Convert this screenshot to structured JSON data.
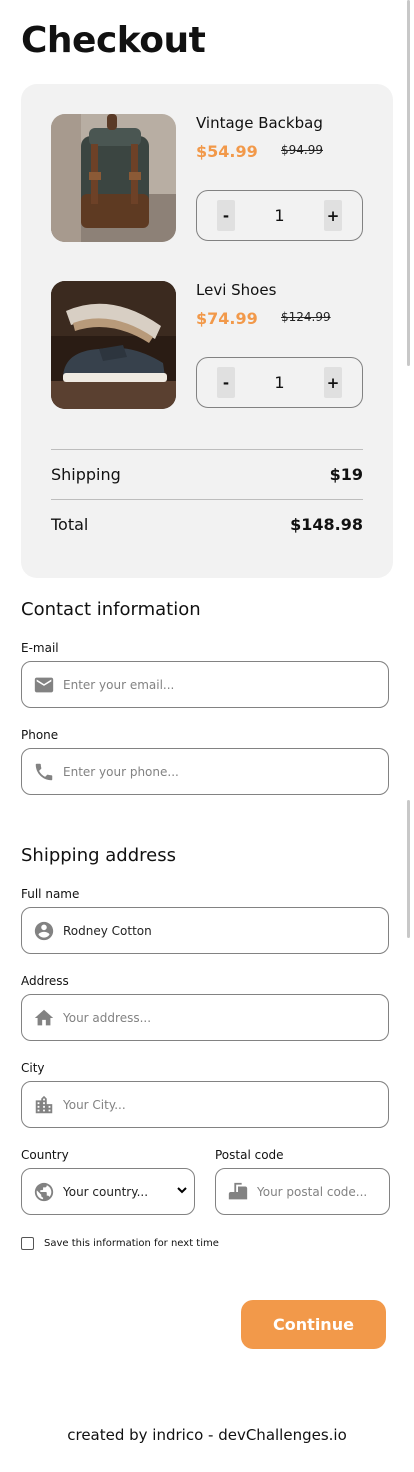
{
  "page": {
    "title": "Checkout"
  },
  "cart": {
    "items": [
      {
        "name": "Vintage Backbag",
        "price": "$54.99",
        "old_price": "$94.99",
        "quantity": "1",
        "minus": "-",
        "plus": "+",
        "image_icon": "backpack-photo"
      },
      {
        "name": "Levi Shoes",
        "price": "$74.99",
        "old_price": "$124.99",
        "quantity": "1",
        "minus": "-",
        "plus": "+",
        "image_icon": "shoe-photo"
      }
    ],
    "shipping": {
      "label": "Shipping",
      "value": "$19"
    },
    "total": {
      "label": "Total",
      "value": "$148.98"
    }
  },
  "contact": {
    "title": "Contact information",
    "email": {
      "label": "E-mail",
      "placeholder": "Enter your email...",
      "icon": "mail-icon"
    },
    "phone": {
      "label": "Phone",
      "placeholder": "Enter your phone...",
      "icon": "phone-icon"
    }
  },
  "shipping_address": {
    "title": "Shipping address",
    "full_name": {
      "label": "Full name",
      "value": "Rodney Cotton",
      "icon": "person-icon"
    },
    "address": {
      "label": "Address",
      "placeholder": "Your address...",
      "icon": "home-icon"
    },
    "city": {
      "label": "City",
      "placeholder": "Your City...",
      "icon": "building-icon"
    },
    "country": {
      "label": "Country",
      "selected": "Your country...",
      "icon": "globe-icon"
    },
    "postal": {
      "label": "Postal code",
      "placeholder": "Your postal code...",
      "icon": "mailbox-icon"
    }
  },
  "save_info": {
    "label": "Save this information for next time",
    "checked": false
  },
  "continue_button": "Continue",
  "footer": "created by indrico - devChallenges.io",
  "colors": {
    "accent": "#f2994a",
    "card_bg": "#f2f2f2",
    "border": "#828282"
  }
}
